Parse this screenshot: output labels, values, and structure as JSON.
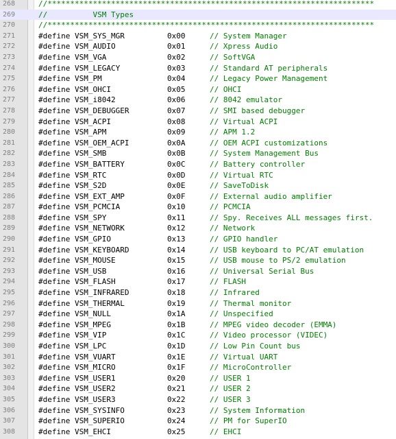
{
  "editor": {
    "highlighted_line": 269,
    "lines": [
      {
        "num": "268",
        "type": "comment",
        "text": "//************************************************************************"
      },
      {
        "num": "269",
        "type": "comment",
        "text": "//          VSM Types"
      },
      {
        "num": "270",
        "type": "comment",
        "text": "//************************************************************************"
      },
      {
        "num": "271",
        "type": "define",
        "name": "#define VSM_SYS_MGR",
        "value": "0x00",
        "comment": "// System Manager"
      },
      {
        "num": "272",
        "type": "define",
        "name": "#define VSM_AUDIO",
        "value": "0x01",
        "comment": "// Xpress Audio"
      },
      {
        "num": "273",
        "type": "define",
        "name": "#define VSM_VGA",
        "value": "0x02",
        "comment": "// SoftVGA"
      },
      {
        "num": "274",
        "type": "define",
        "name": "#define VSM_LEGACY",
        "value": "0x03",
        "comment": "// Standard AT peripherals"
      },
      {
        "num": "275",
        "type": "define",
        "name": "#define VSM_PM",
        "value": "0x04",
        "comment": "// Legacy Power Management"
      },
      {
        "num": "276",
        "type": "define",
        "name": "#define VSM_OHCI",
        "value": "0x05",
        "comment": "// OHCI"
      },
      {
        "num": "277",
        "type": "define",
        "name": "#define VSM_i8042",
        "value": "0x06",
        "comment": "// 8042 emulator"
      },
      {
        "num": "278",
        "type": "define",
        "name": "#define VSM_DEBUGGER",
        "value": "0x07",
        "comment": "// SMI based debugger"
      },
      {
        "num": "279",
        "type": "define",
        "name": "#define VSM_ACPI",
        "value": "0x08",
        "comment": "// Virtual ACPI"
      },
      {
        "num": "280",
        "type": "define",
        "name": "#define VSM_APM",
        "value": "0x09",
        "comment": "// APM 1.2"
      },
      {
        "num": "281",
        "type": "define",
        "name": "#define VSM_OEM_ACPI",
        "value": "0x0A",
        "comment": "// OEM ACPI customizations"
      },
      {
        "num": "282",
        "type": "define",
        "name": "#define VSM_SMB",
        "value": "0x0B",
        "comment": "// System Management Bus"
      },
      {
        "num": "283",
        "type": "define",
        "name": "#define VSM_BATTERY",
        "value": "0x0C",
        "comment": "// Battery controller"
      },
      {
        "num": "284",
        "type": "define",
        "name": "#define VSM_RTC",
        "value": "0x0D",
        "comment": "// Virtual RTC"
      },
      {
        "num": "285",
        "type": "define",
        "name": "#define VSM_S2D",
        "value": "0x0E",
        "comment": "// SaveToDisk"
      },
      {
        "num": "286",
        "type": "define",
        "name": "#define VSM_EXT_AMP",
        "value": "0x0F",
        "comment": "// External audio amplifier"
      },
      {
        "num": "287",
        "type": "define",
        "name": "#define VSM_PCMCIA",
        "value": "0x10",
        "comment": "// PCMCIA"
      },
      {
        "num": "288",
        "type": "define",
        "name": "#define VSM_SPY",
        "value": "0x11",
        "comment": "// Spy. Receives ALL messages first."
      },
      {
        "num": "289",
        "type": "define",
        "name": "#define VSM_NETWORK",
        "value": "0x12",
        "comment": "// Network"
      },
      {
        "num": "290",
        "type": "define",
        "name": "#define VSM_GPIO",
        "value": "0x13",
        "comment": "// GPIO handler"
      },
      {
        "num": "291",
        "type": "define",
        "name": "#define VSM_KEYBOARD",
        "value": "0x14",
        "comment": "// USB keyboard to PC/AT emulation"
      },
      {
        "num": "292",
        "type": "define",
        "name": "#define VSM_MOUSE",
        "value": "0x15",
        "comment": "// USB mouse to PS/2 emulation"
      },
      {
        "num": "293",
        "type": "define",
        "name": "#define VSM_USB",
        "value": "0x16",
        "comment": "// Universal Serial Bus"
      },
      {
        "num": "294",
        "type": "define",
        "name": "#define VSM_FLASH",
        "value": "0x17",
        "comment": "// FLASH"
      },
      {
        "num": "295",
        "type": "define",
        "name": "#define VSM_INFRARED",
        "value": "0x18",
        "comment": "// Infrared"
      },
      {
        "num": "296",
        "type": "define",
        "name": "#define VSM_THERMAL",
        "value": "0x19",
        "comment": "// Thermal monitor"
      },
      {
        "num": "297",
        "type": "define",
        "name": "#define VSM_NULL",
        "value": "0x1A",
        "comment": "// Unspecified"
      },
      {
        "num": "298",
        "type": "define",
        "name": "#define VSM_MPEG",
        "value": "0x1B",
        "comment": "// MPEG video decoder (EMMA)"
      },
      {
        "num": "299",
        "type": "define",
        "name": "#define VSM_VIP",
        "value": "0x1C",
        "comment": "// Video processor (VIDEC)"
      },
      {
        "num": "300",
        "type": "define",
        "name": "#define VSM_LPC",
        "value": "0x1D",
        "comment": "// Low Pin Count bus"
      },
      {
        "num": "301",
        "type": "define",
        "name": "#define VSM_VUART",
        "value": "0x1E",
        "comment": "// Virtual UART"
      },
      {
        "num": "302",
        "type": "define",
        "name": "#define VSM_MICRO",
        "value": "0x1F",
        "comment": "// MicroController"
      },
      {
        "num": "303",
        "type": "define",
        "name": "#define VSM_USER1",
        "value": "0x20",
        "comment": "// USER 1"
      },
      {
        "num": "304",
        "type": "define",
        "name": "#define VSM_USER2",
        "value": "0x21",
        "comment": "// USER 2"
      },
      {
        "num": "305",
        "type": "define",
        "name": "#define VSM_USER3",
        "value": "0x22",
        "comment": "// USER 3"
      },
      {
        "num": "306",
        "type": "define",
        "name": "#define VSM_SYSINFO",
        "value": "0x23",
        "comment": "// System Information"
      },
      {
        "num": "307",
        "type": "define",
        "name": "#define VSM_SUPERIO",
        "value": "0x24",
        "comment": "// PM for SuperIO"
      },
      {
        "num": "308",
        "type": "define",
        "name": "#define VSM_EHCI",
        "value": "0x25",
        "comment": "// EHCI"
      }
    ]
  },
  "colors": {
    "comment": "#008000",
    "gutter_bg": "#e4e4e4",
    "line_number": "#808080",
    "highlight": "#e8e8ff"
  }
}
